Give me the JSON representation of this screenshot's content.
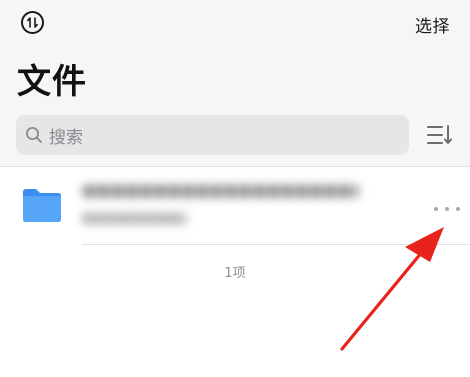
{
  "header": {
    "select_label": "选择",
    "title": "文件"
  },
  "search": {
    "placeholder": "搜索"
  },
  "files": [
    {
      "name": "■■■■■■■■■■■■■■■■■■■■■■",
      "meta": "■■■■■■■■■",
      "icon": "folder-icon"
    }
  ],
  "footer": {
    "item_count": "1项"
  },
  "colors": {
    "background": "#f6f6f7",
    "folder": "#4a9bf3",
    "annotation_arrow": "#e8231c"
  }
}
